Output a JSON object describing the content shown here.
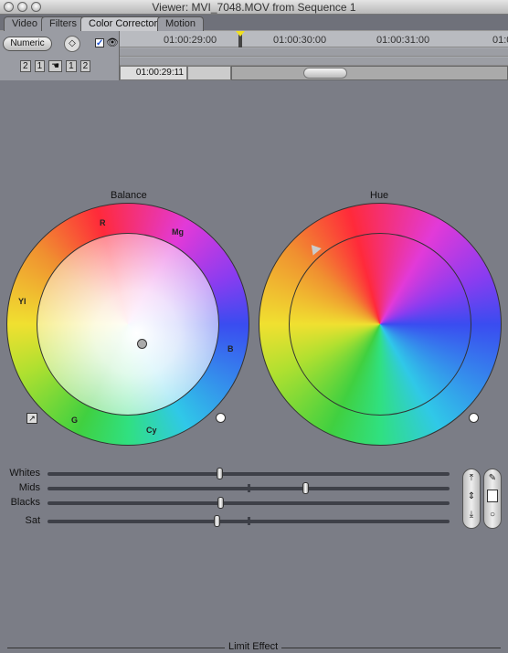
{
  "window": {
    "title": "Viewer: MVI_7048.MOV from Sequence 1"
  },
  "tabs": [
    {
      "label": "Video"
    },
    {
      "label": "Filters"
    },
    {
      "label": "Color Corrector",
      "active": true
    },
    {
      "label": "Motion"
    }
  ],
  "controls": {
    "numeric_label": "Numeric",
    "visible_checked": true,
    "nav_buttons": [
      "2",
      "1",
      "1",
      "2"
    ]
  },
  "timeline": {
    "ticks": [
      "01:00:29:00",
      "01:00:30:00",
      "01:00:31:00",
      "01:0"
    ],
    "current_timecode": "01:00:29:11"
  },
  "balance": {
    "title": "Balance",
    "labels": {
      "r": "R",
      "mg": "Mg",
      "b": "B",
      "cy": "Cy",
      "g": "G",
      "yl": "Yl"
    }
  },
  "hue": {
    "title": "Hue"
  },
  "sliders": [
    {
      "label": "Whites",
      "value": 0.427
    },
    {
      "label": "Mids",
      "value": 0.64,
      "center_tick": true
    },
    {
      "label": "Blacks",
      "value": 0.43
    },
    {
      "label": "Sat",
      "value": 0.42,
      "center_tick": true
    }
  ],
  "footer": {
    "limit_effect": "Limit Effect"
  }
}
